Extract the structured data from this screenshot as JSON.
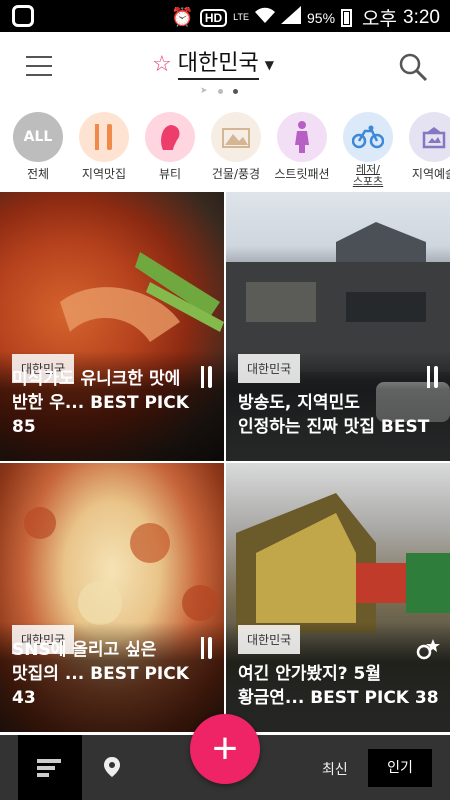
{
  "status": {
    "carrier_text": "오후",
    "time": "3:20",
    "battery": "95%",
    "hd": "HD",
    "lte": "LTE"
  },
  "header": {
    "title": "대한민국"
  },
  "pager": {
    "count": 3,
    "active": 2
  },
  "categories": [
    {
      "label": "전체",
      "circle_text": "ALL",
      "color": "#bdbdbd"
    },
    {
      "label": "지역맛집",
      "color": "#ffe3d2"
    },
    {
      "label": "뷰티",
      "color": "#ffd6e0"
    },
    {
      "label": "건물/풍경",
      "color": "#f6eee4"
    },
    {
      "label": "스트릿패션",
      "color": "#f3dff5"
    },
    {
      "label": "레저/\n스포츠",
      "color": "#dbe9f8"
    },
    {
      "label": "지역예술",
      "color": "#e5e3f2"
    }
  ],
  "cards": [
    {
      "tag": "대한민국",
      "caption": "미식가도 유니크한 맛에\n반한 우... BEST PICK 85",
      "icon": "fork-knife-icon"
    },
    {
      "tag": "대한민국",
      "caption": "방송도, 지역민도\n인정하는 진짜 맛집 BEST",
      "icon": "fork-knife-icon"
    },
    {
      "tag": "대한민국",
      "caption": "SNS에 올리고 싶은\n맛집의 ... BEST PICK 43",
      "icon": "fork-knife-icon"
    },
    {
      "tag": "대한민국",
      "caption": "여긴 안가봤지? 5월\n황금연... BEST PICK 38",
      "icon": "bike-star-icon"
    }
  ],
  "bottom": {
    "recent": "최신",
    "popular": "인기",
    "fab": "+"
  }
}
